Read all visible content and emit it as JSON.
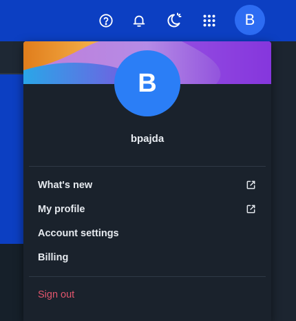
{
  "header": {
    "help_icon": "help-circle-icon",
    "notifications_icon": "bell-icon",
    "theme_icon": "moon-sun-icon",
    "apps_icon": "grid-icon",
    "avatar_initial": "B"
  },
  "profile_menu": {
    "avatar_initial": "B",
    "username": "bpajda",
    "items": [
      {
        "label": "What's new",
        "external": true
      },
      {
        "label": "My profile",
        "external": true
      },
      {
        "label": "Account settings",
        "external": false
      },
      {
        "label": "Billing",
        "external": false
      }
    ],
    "sign_out_label": "Sign out"
  },
  "colors": {
    "header_bg": "#0c3fc2",
    "menu_bg": "#1a222c",
    "avatar": "#2b7ef6",
    "sign_out": "#e2566d"
  }
}
